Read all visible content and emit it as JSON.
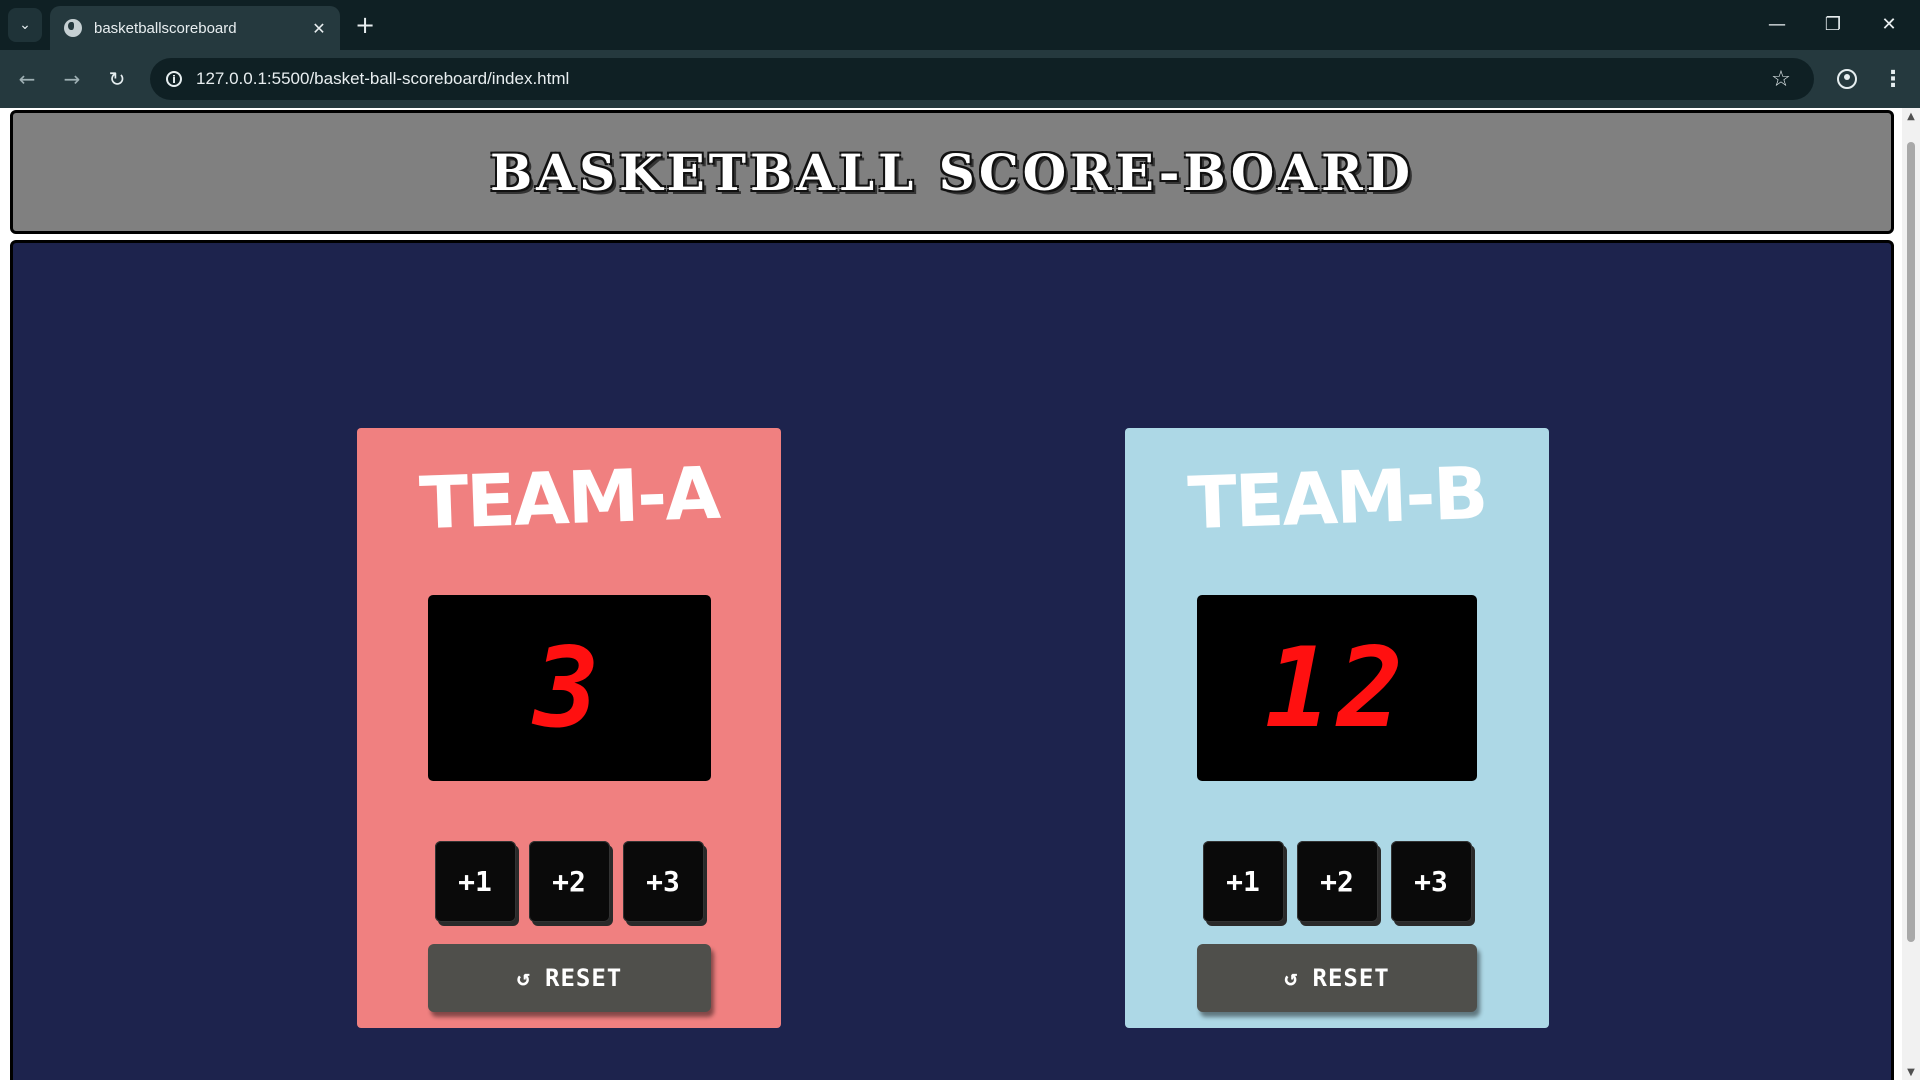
{
  "browser": {
    "tab_title": "basketballscoreboard",
    "url": "127.0.0.1:5500/basket-ball-scoreboard/index.html",
    "icons": {
      "tab_menu": "chevron-down-icon",
      "favicon": "globe-icon",
      "close_tab": "close-icon",
      "new_tab": "plus-icon",
      "back": "arrow-left-icon",
      "forward": "arrow-right-icon",
      "reload": "reload-icon",
      "site_info": "info-icon",
      "bookmark": "star-icon",
      "profile": "profile-icon",
      "menu": "kebab-menu-icon"
    }
  },
  "page": {
    "title": "BASKETBALL SCORE-BOARD",
    "colors": {
      "header_bg": "#808080",
      "main_bg": "#1d234d",
      "team_a_bg": "#f08080",
      "team_b_bg": "#add8e6",
      "score_color": "#ff1010"
    }
  },
  "teams": [
    {
      "name": "TEAM-A",
      "score": "3",
      "buttons": [
        "+1",
        "+2",
        "+3"
      ],
      "reset_label": "RESET"
    },
    {
      "name": "TEAM-B",
      "score": "12",
      "buttons": [
        "+1",
        "+2",
        "+3"
      ],
      "reset_label": "RESET"
    }
  ]
}
